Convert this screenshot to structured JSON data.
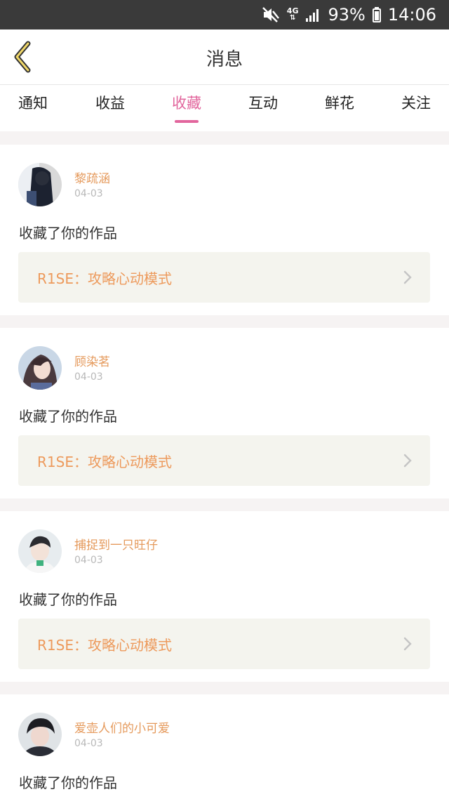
{
  "status_bar": {
    "network": "4G",
    "battery": "93%",
    "time": "14:06",
    "icons": [
      "mute-icon",
      "network-4g-icon",
      "signal-icon",
      "battery-icon"
    ]
  },
  "header": {
    "title": "消息",
    "back_icon": "chevron-left-icon"
  },
  "tabs": [
    {
      "label": "通知"
    },
    {
      "label": "收益"
    },
    {
      "label": "收藏"
    },
    {
      "label": "互动"
    },
    {
      "label": "鲜花"
    },
    {
      "label": "关注"
    }
  ],
  "active_tab": "收藏",
  "colors": {
    "accent": "#e2669d",
    "username": "#e59a5c",
    "work_title": "#ed9a5c",
    "work_bg": "#f4f4ee",
    "status_bar": "#3a3a3a"
  },
  "messages": [
    {
      "user": "黎疏涵",
      "date": "04-03",
      "action": "收藏了你的作品",
      "work": "R1SE：攻略心动模式"
    },
    {
      "user": "顾染茗",
      "date": "04-03",
      "action": "收藏了你的作品",
      "work": "R1SE：攻略心动模式"
    },
    {
      "user": "捕捉到一只旺仔",
      "date": "04-03",
      "action": "收藏了你的作品",
      "work": "R1SE：攻略心动模式"
    },
    {
      "user": "爱壶人们的小可爱",
      "date": "04-03",
      "action": "收藏了你的作品"
    }
  ]
}
